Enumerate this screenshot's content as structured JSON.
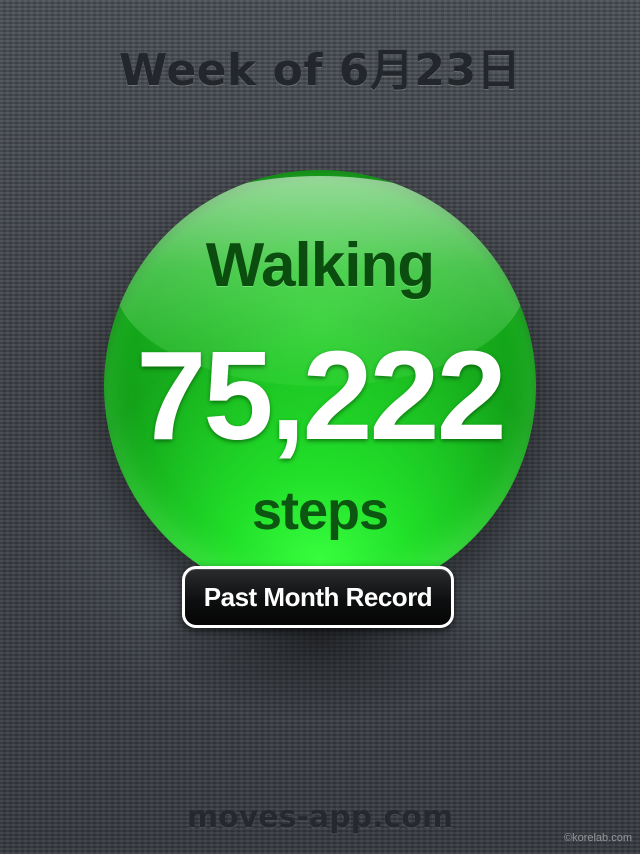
{
  "header": {
    "week_title": "Week of 6月23日"
  },
  "activity_orb": {
    "activity": "Walking",
    "step_count": "75,222",
    "unit": "steps"
  },
  "actions": {
    "record_button_label": "Past Month Record"
  },
  "footer": {
    "url": "moves-app.com",
    "watermark": "©korelab.com"
  },
  "colors": {
    "orb_green": "#22c825",
    "activity_text": "#0b4d0f",
    "button_bg": "#0e0f10",
    "background": "#3c4046"
  }
}
